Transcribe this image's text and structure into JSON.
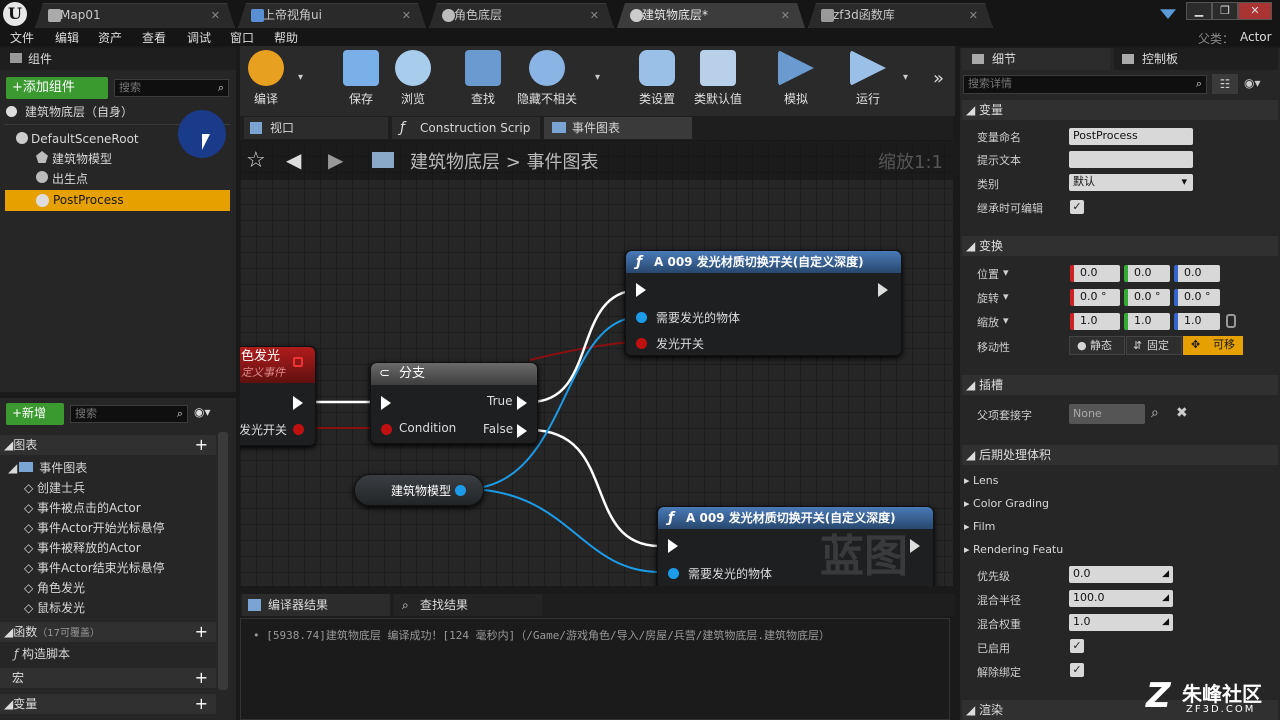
{
  "tabs": [
    {
      "label": "Map01"
    },
    {
      "label": "上帝视角ui"
    },
    {
      "label": "角色底层"
    },
    {
      "label": "建筑物底层*"
    },
    {
      "label": "zf3d函数库"
    }
  ],
  "parent_label": "父类：",
  "parent_value": "Actor",
  "menu": [
    "文件",
    "编辑",
    "资产",
    "查看",
    "调试",
    "窗口",
    "帮助"
  ],
  "components": {
    "title": "组件",
    "add_button": "+添加组件",
    "search_placeholder": "搜索",
    "self_item": "建筑物底层（自身）",
    "root": "DefaultSceneRoot",
    "children": [
      "建筑物模型",
      "出生点",
      "PostProcess"
    ]
  },
  "toolbar": [
    "编译",
    "保存",
    "浏览",
    "查找",
    "隐藏不相关",
    "类设置",
    "类默认值",
    "模拟",
    "运行"
  ],
  "graph_tabs": [
    "视口",
    "Construction Scrip",
    "事件图表"
  ],
  "breadcrumb": {
    "root": "建筑物底层",
    "separator": ">",
    "current": "事件图表",
    "zoom": "缩放1:1"
  },
  "nodes": {
    "event": {
      "title": "色发光",
      "subtitle": "定义事件",
      "pin": "发光开关"
    },
    "branch": {
      "title": "分支",
      "condition": "Condition",
      "true": "True",
      "false": "False"
    },
    "func1": {
      "title": "A 009 发光材质切换开关(自定义深度)",
      "pin_target": "需要发光的物体",
      "pin_switch": "发光开关"
    },
    "func2": {
      "title": "A 009 发光材质切换开关(自定义深度)",
      "pin_target": "需要发光的物体"
    },
    "var": {
      "label": "建筑物模型"
    },
    "watermark": "蓝图"
  },
  "mybp": {
    "new_button": "+新增",
    "search_placeholder": "搜索",
    "graphs_label": "图表",
    "event_graph": "事件图表",
    "events": [
      "创建士兵",
      "事件被点击的Actor",
      "事件Actor开始光标悬停",
      "事件被释放的Actor",
      "事件Actor结束光标悬停",
      "角色发光",
      "鼠标发光"
    ],
    "functions_label": "函数",
    "functions_note": "（17可覆盖）",
    "construct": "构造脚本",
    "macros_label": "宏",
    "vars_label": "变量"
  },
  "bottom": {
    "tab1": "编译器结果",
    "tab2": "查找结果",
    "log": "[5938.74]建筑物底层 编译成功！[124 毫秒内]（/Game/游戏角色/导入/房屋/兵营/建筑物底层.建筑物底层）"
  },
  "details": {
    "title": "细节",
    "title2": "控制板",
    "search_placeholder": "搜索详情",
    "sec_var": "变量",
    "var_name_label": "变量命名",
    "var_name": "PostProcess",
    "tooltip_label": "提示文本",
    "category_label": "类别",
    "category": "默认",
    "editable_label": "继承时可编辑",
    "sec_transform": "变换",
    "location_label": "位置",
    "rotation_label": "旋转",
    "scale_label": "缩放",
    "location": [
      "0.0",
      "0.0",
      "0.0"
    ],
    "rotation": [
      "0.0 °",
      "0.0 °",
      "0.0 °"
    ],
    "scale": [
      "1.0",
      "1.0",
      "1.0"
    ],
    "mobility_label": "移动性",
    "mobility": [
      "静态",
      "固定",
      "可移"
    ],
    "sec_socket": "插槽",
    "socket_label": "父项套接字",
    "socket_value": "None",
    "sec_pp": "后期处理体积",
    "pp_items": [
      "Lens",
      "Color Grading",
      "Film",
      "Rendering Featur"
    ],
    "priority_label": "优先级",
    "priority": "0.0",
    "blend_radius_label": "混合半径",
    "blend_radius": "100.0",
    "blend_weight_label": "混合权重",
    "blend_weight": "1.0",
    "enabled_label": "已启用",
    "unbound_label": "解除绑定",
    "sec_render": "渲染"
  },
  "logo": {
    "brand": "朱峰社区",
    "site": "ZF3D.COM"
  }
}
